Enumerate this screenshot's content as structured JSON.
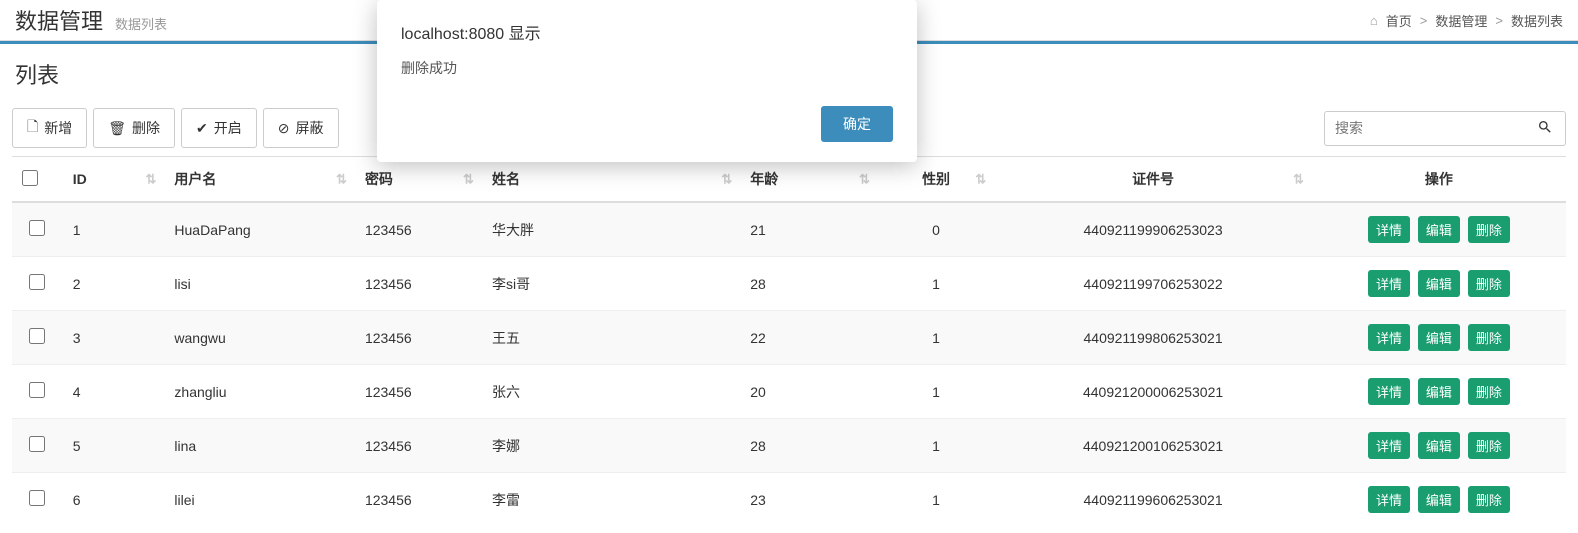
{
  "header": {
    "title": "数据管理",
    "subtitle": "数据列表"
  },
  "breadcrumb": {
    "home_icon": "⌂",
    "home": "首页",
    "item1": "数据管理",
    "item2": "数据列表"
  },
  "panel": {
    "title": "列表"
  },
  "toolbar": {
    "add_label": "新增",
    "delete_label": "删除",
    "enable_label": "开启",
    "disable_label": "屏蔽"
  },
  "search": {
    "placeholder": "搜索"
  },
  "columns": {
    "id": "ID",
    "username": "用户名",
    "password": "密码",
    "name": "姓名",
    "age": "年龄",
    "gender": "性别",
    "idcard": "证件号",
    "actions": "操作"
  },
  "actions": {
    "detail": "详情",
    "edit": "编辑",
    "delete": "删除"
  },
  "rows": [
    {
      "id": "1",
      "username": "HuaDaPang",
      "password": "123456",
      "name": "华大胖",
      "age": "21",
      "gender": "0",
      "idcard": "440921199906253023"
    },
    {
      "id": "2",
      "username": "lisi",
      "password": "123456",
      "name": "李si哥",
      "age": "28",
      "gender": "1",
      "idcard": "440921199706253022"
    },
    {
      "id": "3",
      "username": "wangwu",
      "password": "123456",
      "name": "王五",
      "age": "22",
      "gender": "1",
      "idcard": "440921199806253021"
    },
    {
      "id": "4",
      "username": "zhangliu",
      "password": "123456",
      "name": "张六",
      "age": "20",
      "gender": "1",
      "idcard": "440921200006253021"
    },
    {
      "id": "5",
      "username": "lina",
      "password": "123456",
      "name": "李娜",
      "age": "28",
      "gender": "1",
      "idcard": "440921200106253021"
    },
    {
      "id": "6",
      "username": "lilei",
      "password": "123456",
      "name": "李雷",
      "age": "23",
      "gender": "1",
      "idcard": "440921199606253021"
    }
  ],
  "dialog": {
    "title": "localhost:8080 显示",
    "message": "删除成功",
    "confirm": "确定"
  }
}
